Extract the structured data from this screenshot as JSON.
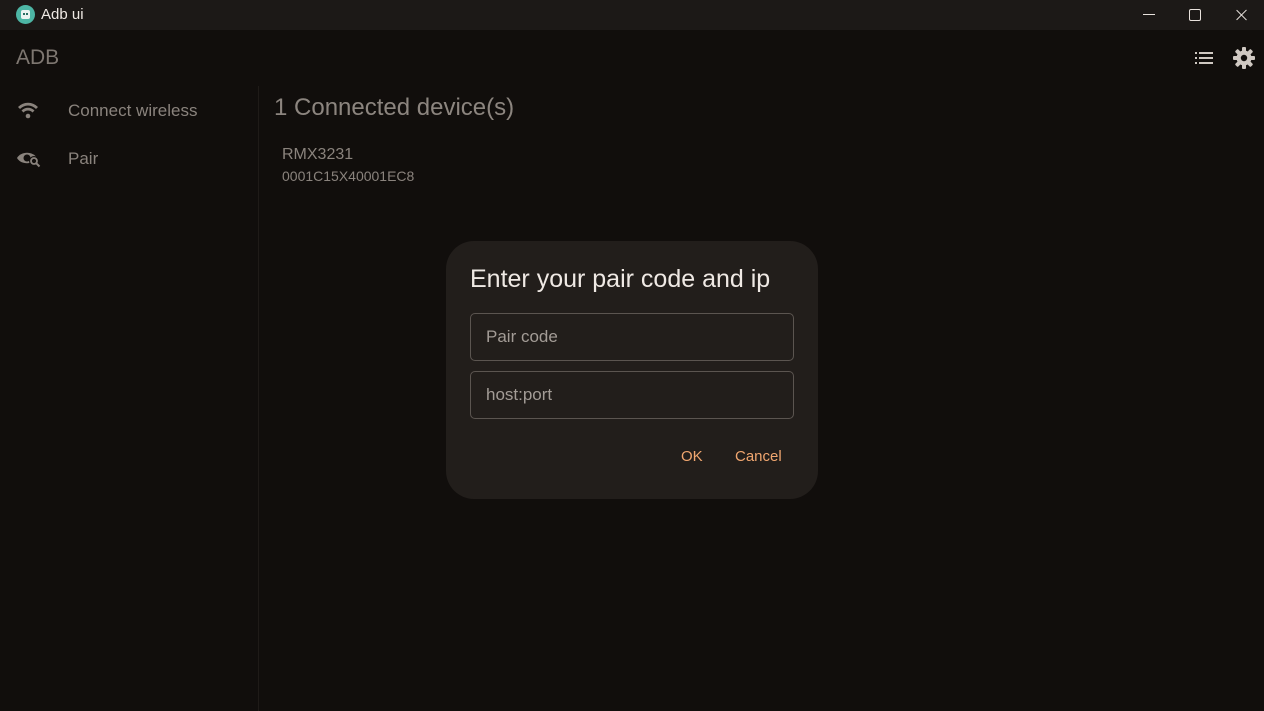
{
  "window": {
    "title": "Adb ui"
  },
  "appbar": {
    "title": "ADB",
    "actions": [
      "list-icon",
      "gear-icon"
    ]
  },
  "sidebar": {
    "items": [
      {
        "label": "Connect wireless",
        "icon": "wifi-icon"
      },
      {
        "label": "Pair",
        "icon": "visibility-icon"
      }
    ]
  },
  "main": {
    "heading": "1 Connected device(s)",
    "devices": [
      {
        "name": "RMX3231",
        "serial": "0001C15X40001EC8"
      }
    ]
  },
  "dialog": {
    "title": "Enter your pair code and ip",
    "pair_code": {
      "placeholder": "Pair code",
      "value": ""
    },
    "host_port": {
      "placeholder": "host:port",
      "value": ""
    },
    "ok_label": "OK",
    "cancel_label": "Cancel"
  },
  "colors": {
    "background": "#110e0c",
    "dialog": "#221e1b",
    "accent": "#f0a66f",
    "app_icon": "#4db6a5"
  }
}
